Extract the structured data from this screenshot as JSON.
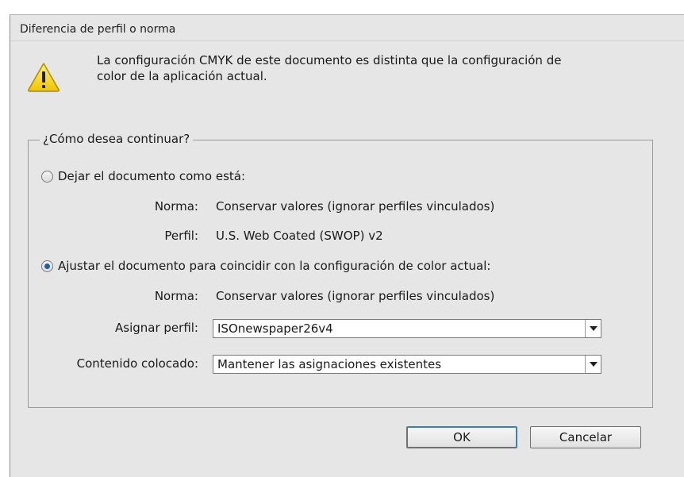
{
  "dialog": {
    "title": "Diferencia de perfil o norma",
    "icon": "warning-icon",
    "message_line1": "La configuración CMYK de este documento es distinta que la configuración de",
    "message_line2": "color de la aplicación actual."
  },
  "group": {
    "legend": "¿Cómo desea continuar?",
    "option1": {
      "label": "Dejar el documento como está:",
      "checked": false,
      "norma_label": "Norma:",
      "norma_value": "Conservar valores (ignorar perfiles vinculados)",
      "perfil_label": "Perfil:",
      "perfil_value": "U.S. Web Coated (SWOP) v2"
    },
    "option2": {
      "label": "Ajustar el documento para coincidir con la configuración de color actual:",
      "checked": true,
      "norma_label": "Norma:",
      "norma_value": "Conservar valores (ignorar perfiles vinculados)",
      "asignar_label": "Asignar perfil:",
      "asignar_value": "ISOnewspaper26v4",
      "contenido_label": "Contenido colocado:",
      "contenido_value": "Mantener las asignaciones existentes"
    }
  },
  "buttons": {
    "ok": "OK",
    "cancel": "Cancelar"
  },
  "colors": {
    "dialog_bg": "#e6e6e6",
    "warning_yellow": "#f5d300",
    "radio_dot": "#1f5fa8"
  }
}
